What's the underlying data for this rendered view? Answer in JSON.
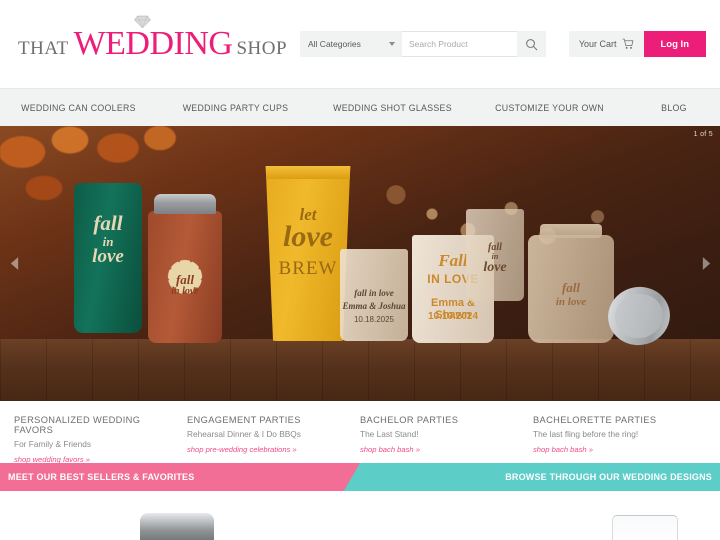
{
  "header": {
    "logo": {
      "part1": "THAT",
      "part2": "WEDDING",
      "part3": "SHOP",
      "icon": "diamond-icon",
      "accent_color": "#ec1e79"
    },
    "search": {
      "category_value": "All Categories",
      "placeholder": "Search Product",
      "search_icon": "magnifier-icon"
    },
    "cart_label": "Your Cart",
    "cart_icon": "shopping-cart-icon",
    "login_label": "Log In"
  },
  "nav": {
    "items": [
      {
        "label": "WEDDING CAN COOLERS"
      },
      {
        "label": "WEDDING PARTY CUPS"
      },
      {
        "label": "WEDDING SHOT GLASSES"
      },
      {
        "label": "CUSTOMIZE YOUR OWN"
      },
      {
        "label": "BLOG"
      }
    ]
  },
  "hero": {
    "slide_counter": "1 of 5",
    "prev_icon": "chevron-left-icon",
    "next_icon": "chevron-right-icon",
    "products": {
      "koozie_green": {
        "line1": "fall",
        "line2": "in",
        "line3": "love"
      },
      "koozie_rust": {
        "line1": "fall",
        "line2": "in love"
      },
      "cup_yellow": {
        "line1": "let",
        "line2": "love",
        "line3": "BREW"
      },
      "shot_glass_a": {
        "line1": "fall in love",
        "line2": "Emma & Joshua",
        "line3": "10.18.2025"
      },
      "shot_glass_b": {
        "line1": "Fall",
        "line2": "IN LOVE",
        "line3": "Emma & Shawn",
        "line4": "10.10.2024"
      },
      "shot_glass_c": {
        "line1": "fall",
        "line2": "in",
        "line3": "love"
      },
      "mason_jar": {
        "line1": "fall",
        "line2": "in love"
      }
    }
  },
  "promos": [
    {
      "title": "PERSONALIZED WEDDING FAVORS",
      "subtitle": "For Family & Friends",
      "link": "shop wedding favors »"
    },
    {
      "title": "ENGAGEMENT PARTIES",
      "subtitle": "Rehearsal Dinner & I Do BBQs",
      "link": "shop pre-wedding celebrations »"
    },
    {
      "title": "BACHELOR PARTIES",
      "subtitle": "The Last Stand!",
      "link": "shop bach bash »"
    },
    {
      "title": "BACHELORETTE PARTIES",
      "subtitle": "The last fling before the ring!",
      "link": "shop bach bash »"
    }
  ],
  "banner": {
    "left_text": "MEET OUR BEST SELLERS & FAVORITES",
    "right_text": "BROWSE THROUGH OUR WEDDING DESIGNS",
    "left_color": "#f26e96",
    "right_color": "#5ccdc7"
  }
}
